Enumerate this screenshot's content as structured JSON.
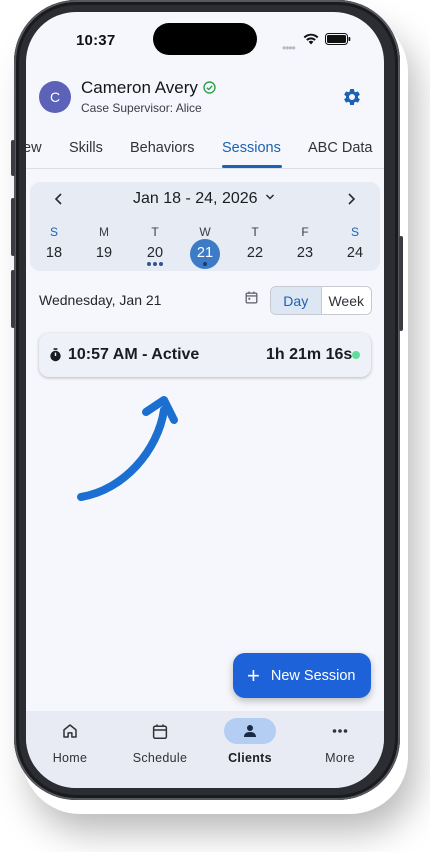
{
  "status_bar": {
    "time": "10:37",
    "dots": "••••"
  },
  "client": {
    "initial": "C",
    "name": "Cameron Avery",
    "supervisor": "Case Supervisor: Alice"
  },
  "tabs": [
    {
      "label": "ew"
    },
    {
      "label": "Skills"
    },
    {
      "label": "Behaviors"
    },
    {
      "label": "Sessions",
      "active": true
    },
    {
      "label": "ABC Data"
    }
  ],
  "calendar": {
    "range": "Jan 18 - 24, 2026",
    "days": [
      {
        "dow": "S",
        "num": "18"
      },
      {
        "dow": "M",
        "num": "19"
      },
      {
        "dow": "T",
        "num": "20",
        "events": 3
      },
      {
        "dow": "W",
        "num": "21",
        "selected": true
      },
      {
        "dow": "T",
        "num": "22"
      },
      {
        "dow": "F",
        "num": "23"
      },
      {
        "dow": "S",
        "num": "24"
      }
    ]
  },
  "selected_date": "Wednesday, Jan 21",
  "view_toggle": {
    "day": "Day",
    "week": "Week",
    "selected": "Day"
  },
  "session": {
    "label": "10:57 AM - Active",
    "elapsed": "1h 21m 16s",
    "status_color": "#5fdd9c"
  },
  "fab": {
    "plus": "+",
    "label": "New Session"
  },
  "bottom_nav": [
    {
      "label": "Home",
      "icon": "home-icon"
    },
    {
      "label": "Schedule",
      "icon": "calendar-icon"
    },
    {
      "label": "Clients",
      "icon": "person-icon",
      "active": true
    },
    {
      "label": "More",
      "icon": "more-icon"
    }
  ],
  "colors": {
    "accent": "#1d62b0",
    "fab": "#1d62d8",
    "annotation_arrow": "#1a6fd1"
  }
}
